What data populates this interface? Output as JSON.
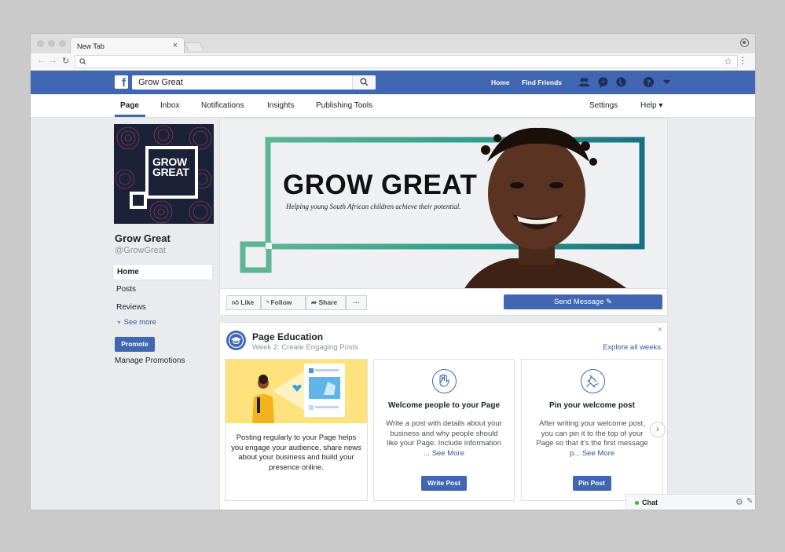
{
  "browser": {
    "tab_title": "New Tab",
    "tab_close": "×"
  },
  "fb": {
    "logo": "f",
    "search_value": "Grow Great",
    "nav_home": "Home",
    "nav_find_friends": "Find Friends"
  },
  "page_nav": {
    "page": "Page",
    "inbox": "Inbox",
    "notifications": "Notifications",
    "insights": "Insights",
    "publishing_tools": "Publishing Tools",
    "settings": "Settings",
    "help": "Help ▾"
  },
  "profile": {
    "logo_line1": "GROW",
    "logo_line2": "GREAT",
    "name": "Grow Great",
    "handle": "@GrowGreat"
  },
  "left_nav": {
    "home": "Home",
    "posts": "Posts",
    "reviews": "Reviews",
    "see_more": "See more",
    "promote": "Promote",
    "manage_promotions": "Manage Promotions"
  },
  "cover": {
    "title": "GROW GREAT",
    "tagline": "Helping young South African children achieve their potential."
  },
  "actions": {
    "like": "Like",
    "follow": "Follow",
    "share": "Share",
    "more": "···",
    "send_message": "Send Message"
  },
  "education": {
    "title": "Page Education",
    "subtitle": "Week 2: Create Engaging Posts",
    "explore": "Explore all weeks",
    "close": "×",
    "card1_text": "Posting regularly to your Page helps you engage your audience, share news about your business and build your presence online.",
    "card2_title": "Welcome people to your Page",
    "card2_desc": "Write a post with details about your business and why people should like your Page. Include information ...",
    "card2_more": "See More",
    "card2_button": "Write Post",
    "card3_title": "Pin your welcome post",
    "card3_desc": "After writing your welcome post, you can pin it to the top of your Page so that it's the first message p...",
    "card3_more": "See More",
    "card3_button": "Pin Post",
    "next": "›"
  },
  "chat": {
    "label": "Chat"
  },
  "colors": {
    "fb_blue": "#4267b2",
    "link": "#365899",
    "cover_teal": "#3ba691",
    "profile_bg": "#1b2237"
  }
}
